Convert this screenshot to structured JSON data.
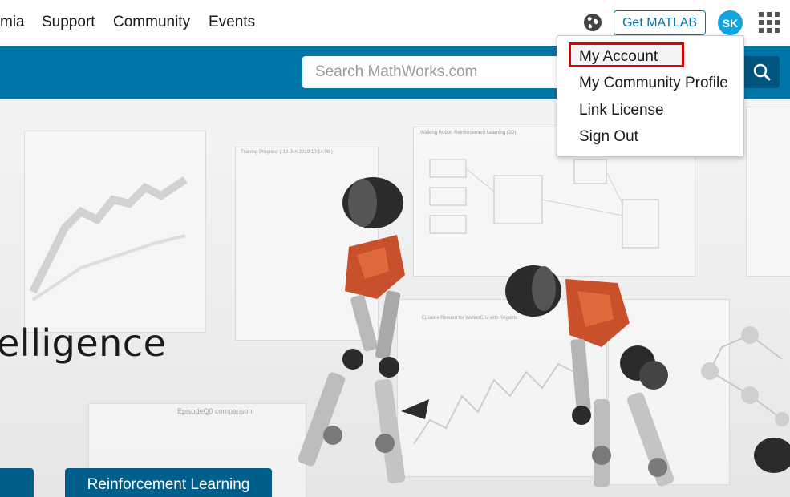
{
  "nav": {
    "items": [
      "mia",
      "Support",
      "Community",
      "Events"
    ],
    "get_matlab": "Get MATLAB",
    "avatar_initials": "SK",
    "globe_icon": "globe-icon",
    "apps_icon": "apps-grid-icon"
  },
  "search": {
    "placeholder": "Search MathWorks.com",
    "icon": "search-icon"
  },
  "account_menu": {
    "items": [
      "My Account",
      "My Community Profile",
      "Link License",
      "Sign Out"
    ],
    "highlighted": "My Account"
  },
  "hero": {
    "heading": "elligence",
    "button_label": "Reinforcement Learning",
    "graphics": {
      "panel1_title": "Training Progress ( 18-Jun-2019 10:14:08 )",
      "panel2_title": "Walking Robot: Reinforcement Learning (2D)",
      "panel3_title": "EpisodeQ0 comparison",
      "panel4_title": "Episode Reward for WalkerEnv with rlAgents"
    }
  },
  "colors": {
    "brand_blue": "#0076a8",
    "button_blue": "#005e8a",
    "avatar_blue": "#0ea5e0",
    "highlight_red": "#e00000"
  }
}
